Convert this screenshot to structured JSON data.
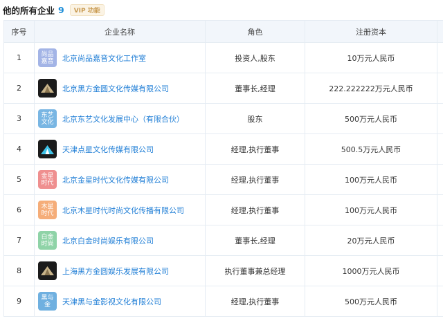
{
  "header": {
    "title": "他的所有企业",
    "count": "9",
    "vip_label": "VIP 功能"
  },
  "table": {
    "columns": [
      "序号",
      "企业名称",
      "角色",
      "注册资本"
    ],
    "rows": [
      {
        "index": "1",
        "logo_text": "尚品\n嘉音",
        "logo_color": "#a3b4e6",
        "logo_type": "text",
        "name": "北京尚品嘉音文化工作室",
        "role": "投资人,股东",
        "capital": "10万元人民币"
      },
      {
        "index": "2",
        "logo_text": "",
        "logo_color": "#1b1b1b",
        "logo_type": "mountain",
        "name": "北京黑方金圆文化传媒有限公司",
        "role": "董事长,经理",
        "capital": "222.222222万元人民币"
      },
      {
        "index": "3",
        "logo_text": "东艺\n文化",
        "logo_color": "#79b6e3",
        "logo_type": "text",
        "name": "北京东艺文化发展中心（有限合伙）",
        "role": "股东",
        "capital": "500万元人民币"
      },
      {
        "index": "4",
        "logo_text": "",
        "logo_color": "#1b1b1b",
        "logo_type": "star-mountain",
        "name": "天津点星文化传媒有限公司",
        "role": "经理,执行董事",
        "capital": "500.5万元人民币"
      },
      {
        "index": "5",
        "logo_text": "金星\n时代",
        "logo_color": "#ef8f8f",
        "logo_type": "text",
        "name": "北京金星时代文化传媒有限公司",
        "role": "经理,执行董事",
        "capital": "100万元人民币"
      },
      {
        "index": "6",
        "logo_text": "木星\n时代",
        "logo_color": "#f5ad79",
        "logo_type": "text",
        "name": "北京木星时代时尚文化传播有限公司",
        "role": "经理,执行董事",
        "capital": "100万元人民币"
      },
      {
        "index": "7",
        "logo_text": "白金\n时尚",
        "logo_color": "#8fd3a7",
        "logo_type": "text",
        "name": "北京白金时尚娱乐有限公司",
        "role": "董事长,经理",
        "capital": "20万元人民币"
      },
      {
        "index": "8",
        "logo_text": "",
        "logo_color": "#1b1b1b",
        "logo_type": "mountain",
        "name": "上海黑方金圆娱乐发展有限公司",
        "role": "执行董事兼总经理",
        "capital": "1000万元人民币"
      },
      {
        "index": "9",
        "logo_text": "黑与\n金",
        "logo_color": "#6fb0e0",
        "logo_type": "text",
        "name": "天津黑与金影视文化有限公司",
        "role": "经理,执行董事",
        "capital": "500万元人民币"
      }
    ]
  }
}
